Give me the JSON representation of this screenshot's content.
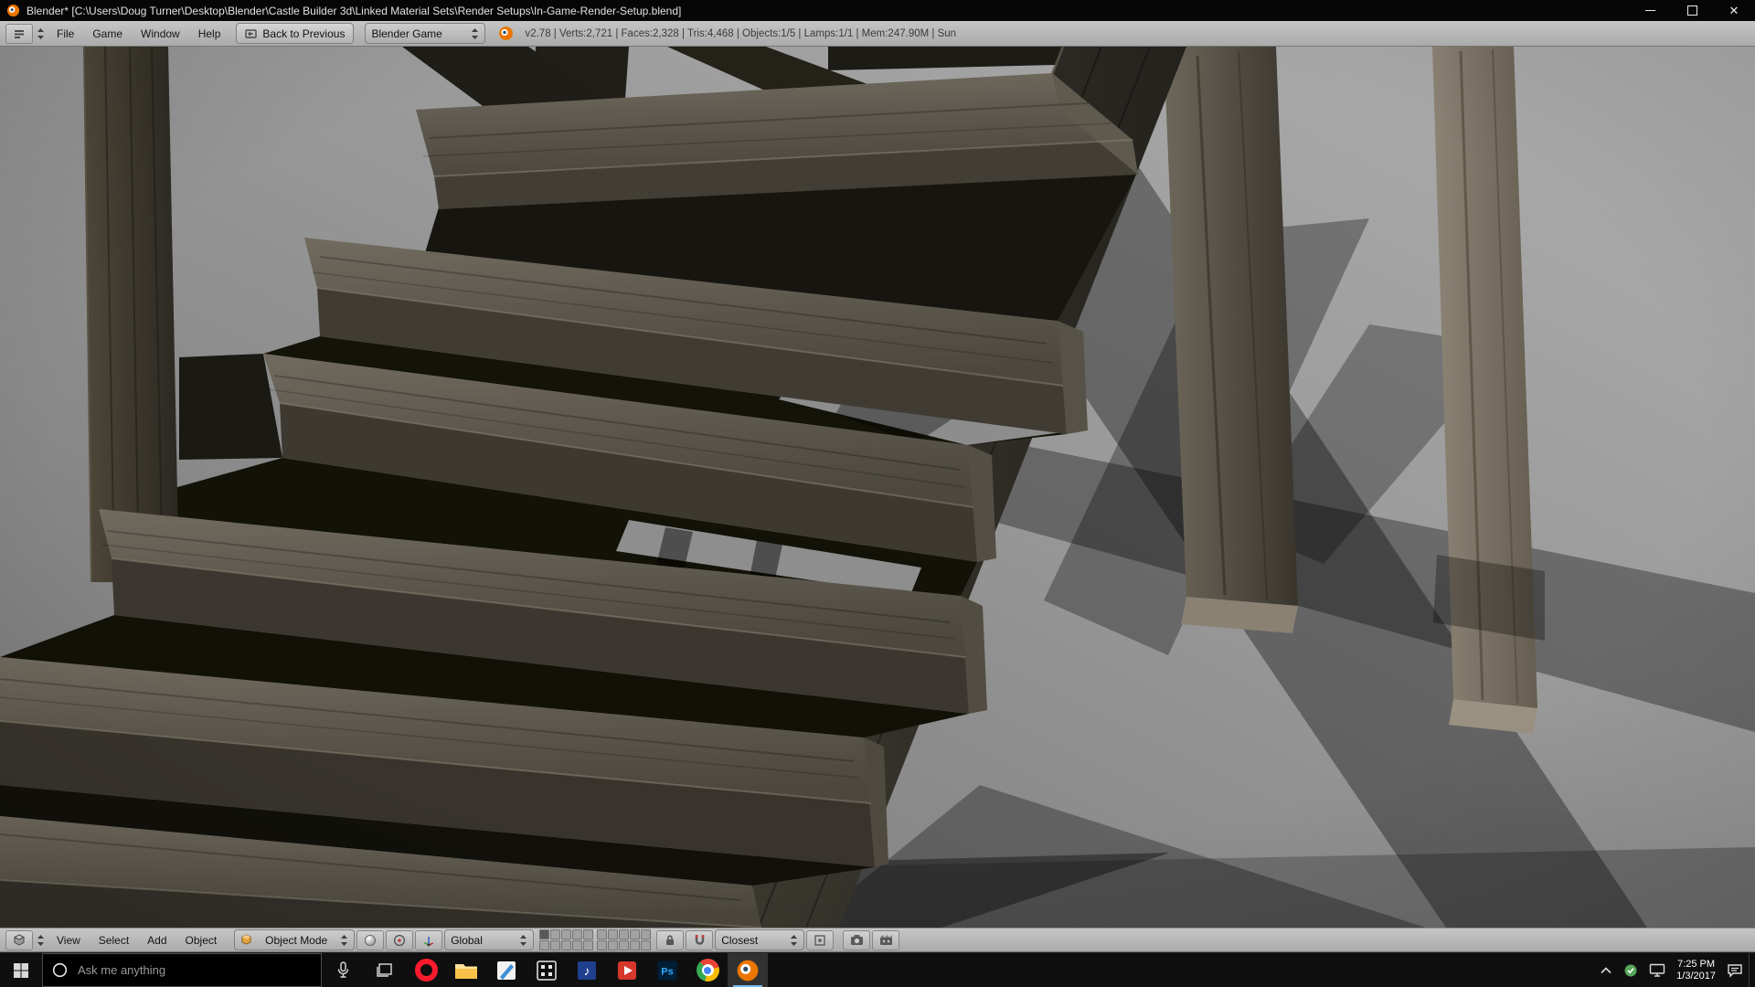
{
  "colors": {
    "blender_orange": "#ea7600",
    "accent_blue": "#76b9ed",
    "header_gray": "#b4b4b4",
    "taskbar_bg": "#0f0f0f",
    "wall_gray": "#9a9a9a",
    "wood_dark": "#3b3730"
  },
  "window": {
    "title": "Blender* [C:\\Users\\Doug Turner\\Desktop\\Blender\\Castle Builder 3d\\Linked Material Sets\\Render Setups\\In-Game-Render-Setup.blend]"
  },
  "top_header": {
    "menus": [
      {
        "label": "File"
      },
      {
        "label": "Game"
      },
      {
        "label": "Window"
      },
      {
        "label": "Help"
      }
    ],
    "back_button_label": "Back to Previous",
    "engine_select_value": "Blender Game",
    "stats": "v2.78 | Verts:2,721 | Faces:2,328 | Tris:4,468 | Objects:1/5 | Lamps:1/1 | Mem:247.90M | Sun"
  },
  "viewport_scene": {
    "subject": "weathered wooden staircase rendered against gray wall with cast shadows"
  },
  "bottom_header": {
    "menus": [
      {
        "label": "View"
      },
      {
        "label": "Select"
      },
      {
        "label": "Add"
      },
      {
        "label": "Object"
      }
    ],
    "mode_select_value": "Object Mode",
    "orientation_select_value": "Global",
    "snap_select_value": "Closest",
    "layers": {
      "groups": 2,
      "per_group": 10,
      "active": [
        0
      ]
    }
  },
  "taskbar": {
    "search_placeholder": "Ask me anything",
    "apps": [
      {
        "icon": "red-ring-app"
      },
      {
        "icon": "file-explorer"
      },
      {
        "icon": "notes-app"
      },
      {
        "icon": "grid-app"
      },
      {
        "icon": "music-app"
      },
      {
        "icon": "media-app"
      },
      {
        "icon": "photoshop"
      },
      {
        "icon": "chrome"
      },
      {
        "icon": "blender",
        "active": true
      }
    ],
    "app_labels": {
      "photoshop_glyph": "Ps",
      "music_glyph": "♪"
    },
    "tray": {
      "time": "7:25 PM",
      "date": "1/3/2017"
    }
  },
  "icons": {
    "titlebar": [
      "blender-logo-icon",
      "minimize-icon",
      "restore-icon",
      "close-icon"
    ],
    "top_header": [
      "editor-type-info-icon",
      "stepper-arrows-icon",
      "back-arrow-icon",
      "blender-logo-icon"
    ],
    "bottom_header": [
      "editor-type-3d-icon",
      "stepper-arrows-icon",
      "object-mode-cube-icon",
      "shading-sphere-icon",
      "pivot-center-icon",
      "manipulator-axis-icon",
      "layers-grid-icon",
      "lock-icon",
      "magnet-icon",
      "snap-target-icon",
      "render-camera-icon",
      "render-animation-icon"
    ],
    "taskbar": [
      "start-icon",
      "cortana-circle-icon",
      "microphone-icon",
      "task-view-icon",
      "tray-chevron-icon",
      "tray-green-icon",
      "tray-display-icon",
      "action-center-icon",
      "show-desktop-edge"
    ]
  }
}
